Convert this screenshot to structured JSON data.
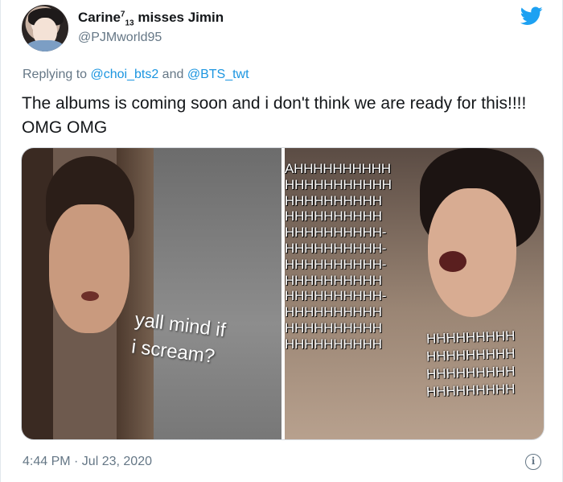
{
  "header": {
    "display_name": "Carine",
    "name_sup": "7",
    "name_sub": "13",
    "name_suffix": " misses Jimin",
    "handle": "@PJMworld95",
    "bird_icon": "twitter-bird-icon",
    "brand_color": "#1da1f2"
  },
  "reply": {
    "prefix": "Replying to ",
    "mention1": "@choi_bts2",
    "conjunction": " and ",
    "mention2": "@BTS_twt"
  },
  "tweet": {
    "text": "The albums is coming soon and i don't think we are ready for this!!!! OMG OMG"
  },
  "media": {
    "left_caption": "yall mind if\ni scream?",
    "scream_lines": [
      "AHHHHHHHHHH",
      "HHHHHHHHHHH",
      " HHHHHHHHHH",
      " HHHHHHHHHH",
      "HHHHHHHHHH-",
      "HHHHHHHHHH-",
      "HHHHHHHHHH-",
      " HHHHHHHHHH",
      "HHHHHHHHHH-",
      "HHHHHHHHHH",
      "HHHHHHHHHH",
      "HHHHHHHHHH"
    ],
    "scream_overlay": [
      "HHHHHHHHH",
      "HHHHHHHHH",
      "HHHHHHHHH",
      "HHHHHHHHH"
    ]
  },
  "footer": {
    "timestamp": "4:44 PM · Jul 23, 2020",
    "info_icon": "info-icon"
  }
}
